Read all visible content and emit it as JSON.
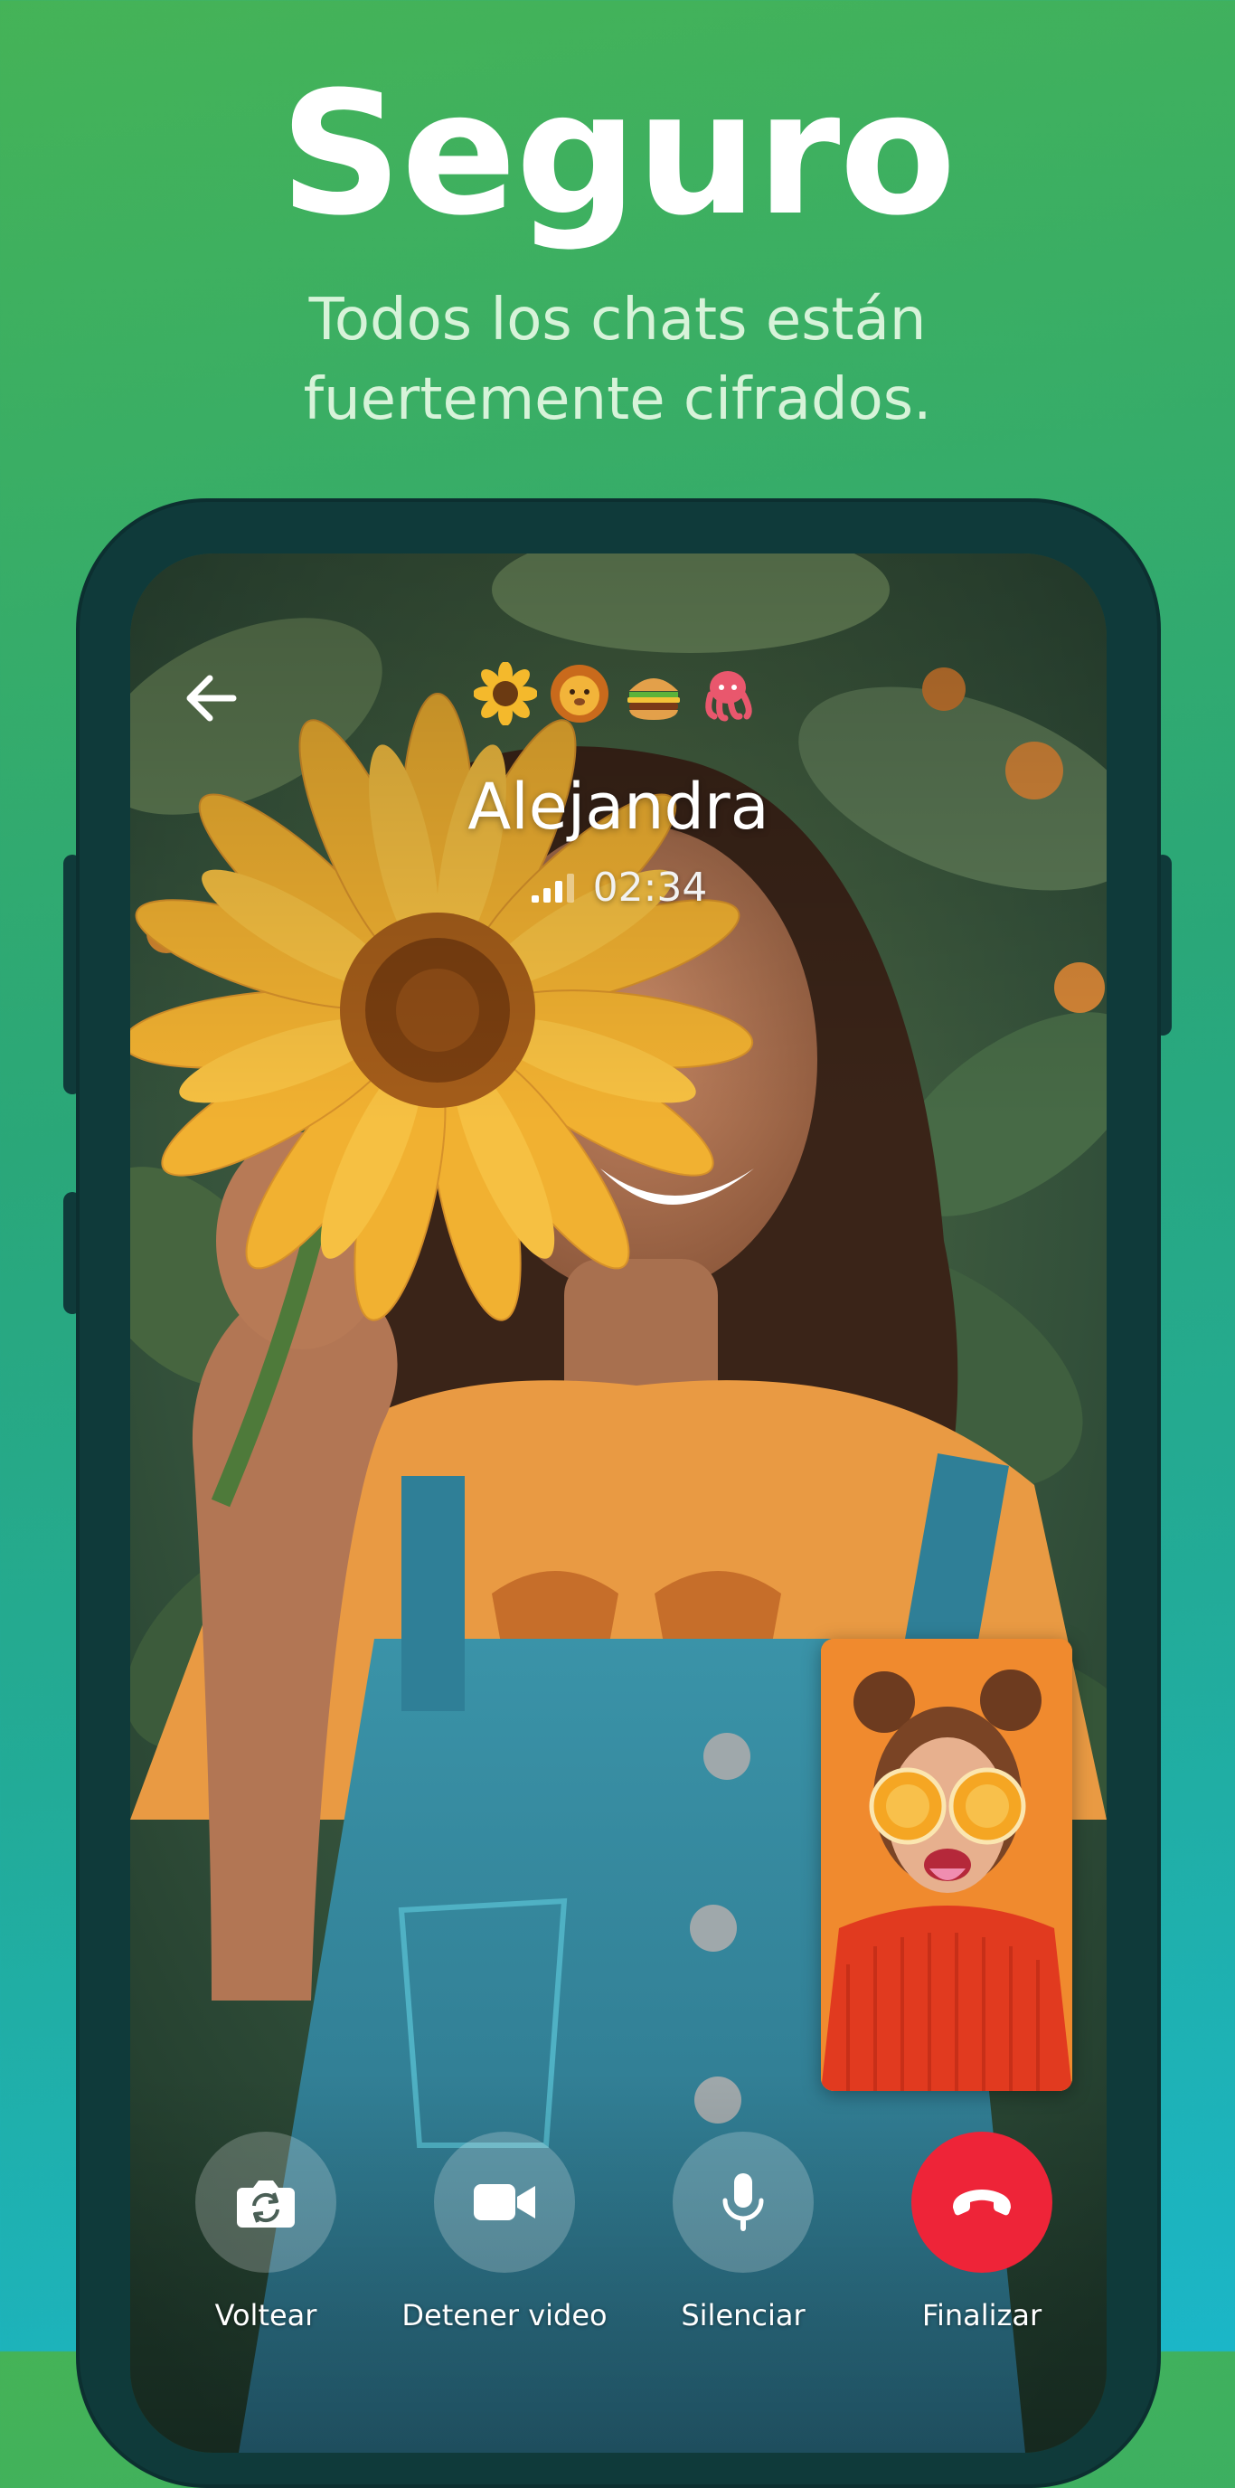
{
  "promo": {
    "title": "Seguro",
    "subtitle_line1": "Todos los chats están",
    "subtitle_line2": "fuertemente cifrados."
  },
  "call": {
    "emoji_key": [
      "🌻",
      "🦁",
      "🍔",
      "🐙"
    ],
    "caller_name": "Alejandra",
    "duration": "02:34",
    "signal_bars_active": 3,
    "signal_bars_total": 4
  },
  "controls": [
    {
      "label": "Voltear",
      "icon": "camera-flip-icon"
    },
    {
      "label": "Detener video",
      "icon": "video-camera-icon"
    },
    {
      "label": "Silenciar",
      "icon": "microphone-icon"
    },
    {
      "label": "Finalizar",
      "icon": "hang-up-icon"
    }
  ],
  "colors": {
    "background_top": "#45b357",
    "background_bottom": "#1bb6c8",
    "phone_frame": "#0f3a3a",
    "end_call": "#ee2438",
    "pip_background": "#f08a2e"
  }
}
